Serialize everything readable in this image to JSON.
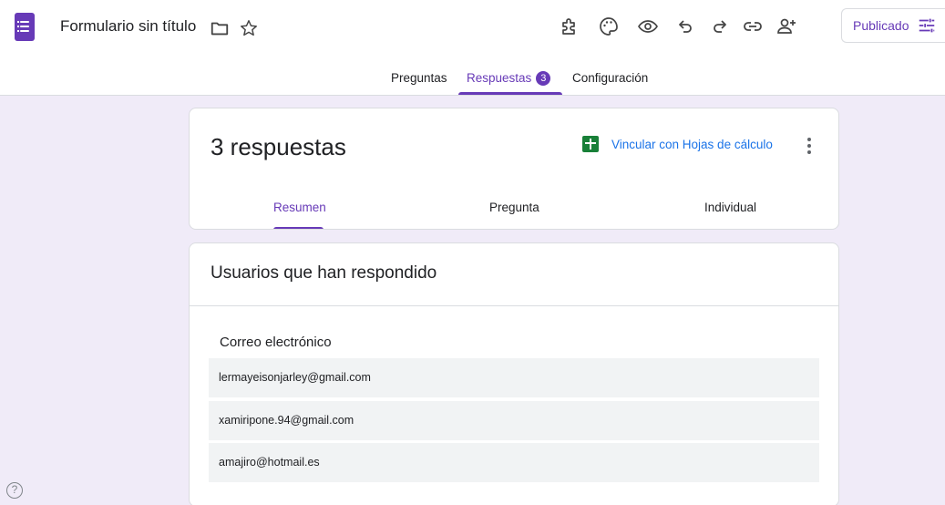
{
  "header": {
    "title": "Formulario sin título",
    "icons": [
      "forms-logo-icon",
      "folder-icon",
      "star-icon",
      "addon-puzzle-icon",
      "palette-icon",
      "eye-preview-icon",
      "undo-icon",
      "redo-icon",
      "link-icon",
      "person-add-icon",
      "tune-icon"
    ],
    "publish_label": "Publicado"
  },
  "tabs": {
    "questions": "Preguntas",
    "responses": "Respuestas",
    "responses_count": "3",
    "settings": "Configuración"
  },
  "summary_card": {
    "count_label": "3 respuestas",
    "sheets_link": "Vincular con Hojas de cálculo",
    "sub_tabs": [
      "Resumen",
      "Pregunta",
      "Individual"
    ],
    "active_sub_tab": "Resumen"
  },
  "responders_card": {
    "title": "Usuarios que han respondido",
    "column_header": "Correo electrónico",
    "emails": [
      "lermayeisonjarley@gmail.com",
      "xamiripone.94@gmail.com",
      "amajiro@hotmail.es"
    ]
  },
  "help": {
    "label": "?"
  },
  "colors": {
    "accent": "#673ab7",
    "link": "#1a73e8",
    "sheets": "#188038",
    "background": "#f0ebf8",
    "row": "#f1f3f4"
  }
}
